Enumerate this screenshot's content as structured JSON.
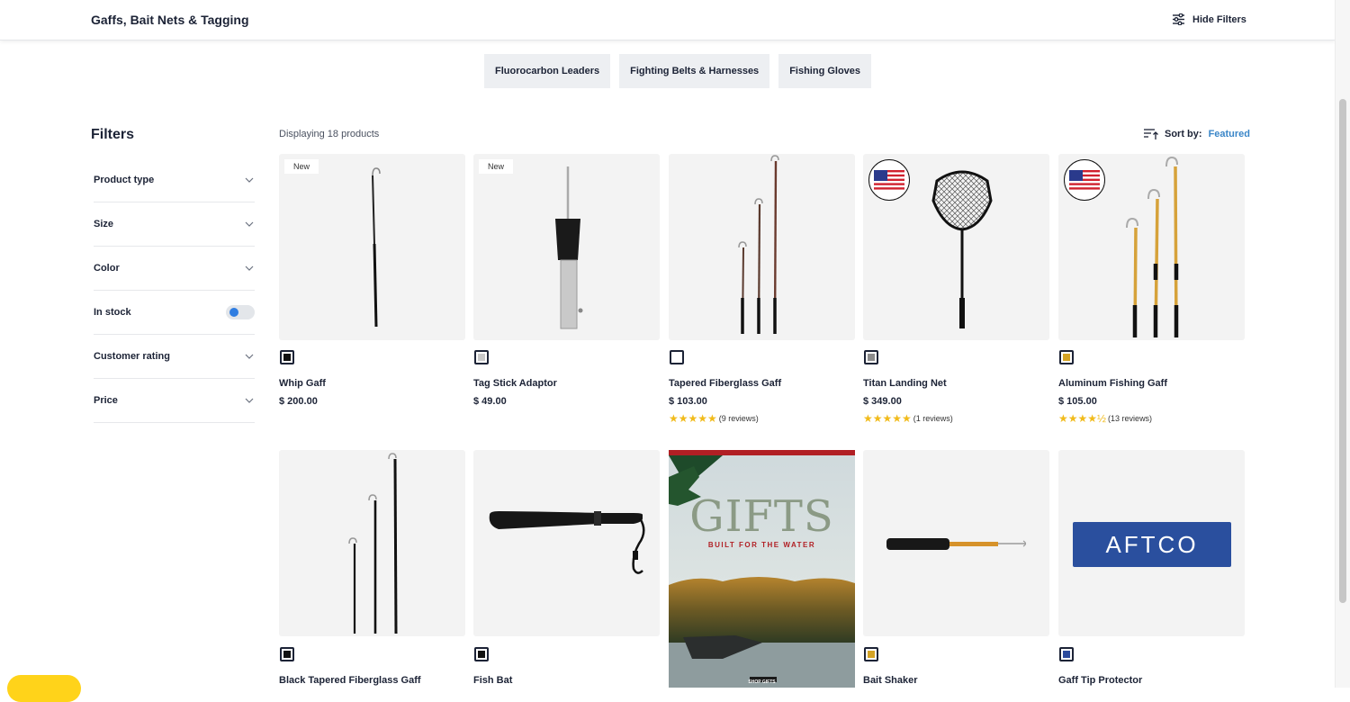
{
  "header": {
    "title": "Gaffs, Bait Nets & Tagging",
    "hide_filters": "Hide Filters"
  },
  "chips": [
    "Fluorocarbon Leaders",
    "Fighting Belts & Harnesses",
    "Fishing Gloves"
  ],
  "filters": {
    "title": "Filters",
    "items": [
      {
        "label": "Product type",
        "type": "dropdown"
      },
      {
        "label": "Size",
        "type": "dropdown"
      },
      {
        "label": "Color",
        "type": "dropdown"
      },
      {
        "label": "In stock",
        "type": "toggle"
      },
      {
        "label": "Customer rating",
        "type": "dropdown"
      },
      {
        "label": "Price",
        "type": "dropdown"
      }
    ]
  },
  "listing": {
    "count_text": "Displaying 18 products",
    "sort_label": "Sort by:",
    "sort_value": "Featured"
  },
  "products": [
    {
      "name": "Whip Gaff",
      "price": "$ 200.00",
      "badge": "New",
      "swatch": "#111111",
      "reviews": ""
    },
    {
      "name": "Tag Stick Adaptor",
      "price": "$ 49.00",
      "badge": "New",
      "swatch": "#c8c8c8",
      "reviews": ""
    },
    {
      "name": "Tapered Fiberglass Gaff",
      "price": "$ 103.00",
      "badge": "",
      "swatch": "#ffffff",
      "rating": 5,
      "reviews": "(9 reviews)"
    },
    {
      "name": "Titan Landing Net",
      "price": "$ 349.00",
      "badge": "",
      "flag": true,
      "swatch": "#8c8c8c",
      "rating": 5,
      "reviews": "(1 reviews)"
    },
    {
      "name": "Aluminum Fishing Gaff",
      "price": "$ 105.00",
      "badge": "",
      "flag": true,
      "swatch": "#d4a325",
      "rating": 4.5,
      "reviews": "(13 reviews)"
    },
    {
      "name": "Black Tapered Fiberglass Gaff",
      "swatch": "#111111"
    },
    {
      "name": "Fish Bat",
      "swatch": "#111111"
    },
    {
      "name": "Bait Shaker",
      "swatch": "#d4a325"
    },
    {
      "name": "Gaff Tip Protector",
      "swatch": "#2b4a9c"
    }
  ],
  "promo": {
    "headline": "GIFTS",
    "subline": "BUILT FOR THE WATER",
    "cta": "SHOP GIFTS"
  },
  "aftco_logo": "AFTCO"
}
